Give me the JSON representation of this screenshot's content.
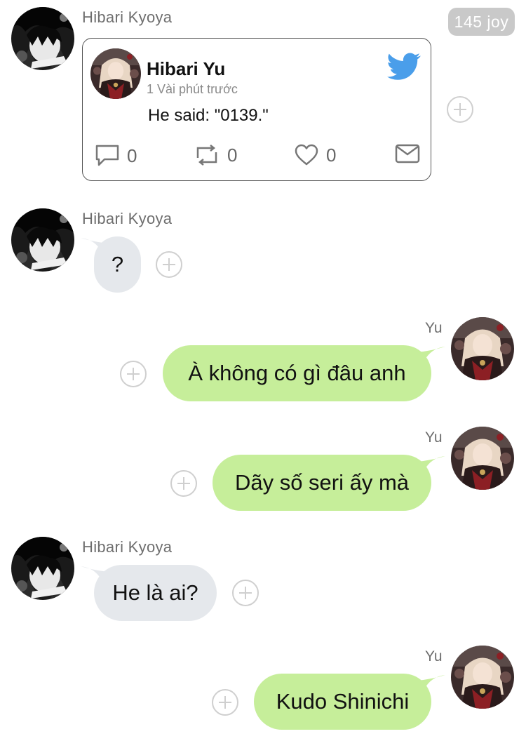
{
  "badge": {
    "text": "145 joy"
  },
  "names": {
    "other": "Hibari Kyoya",
    "self": "Yu"
  },
  "tweet": {
    "author": "Hibari Yu",
    "time": "1 Vài phút trước",
    "text": "He said: \"0139.\"",
    "replies": "0",
    "retweets": "0",
    "likes": "0"
  },
  "messages": [
    {
      "sender": "Hibari Kyoya",
      "direction": "incoming",
      "type": "tweet-share"
    },
    {
      "sender": "Hibari Kyoya",
      "direction": "incoming",
      "text": "?"
    },
    {
      "sender": "Yu",
      "direction": "outgoing",
      "text": "À không có gì đâu anh"
    },
    {
      "sender": "Yu",
      "direction": "outgoing",
      "text": "Dãy số seri ấy mà"
    },
    {
      "sender": "Hibari Kyoya",
      "direction": "incoming",
      "text": "He là ai?"
    },
    {
      "sender": "Yu",
      "direction": "outgoing",
      "text": "Kudo Shinichi"
    }
  ],
  "colors": {
    "incoming_bubble": "#e5e8ec",
    "outgoing_bubble": "#c6ee9a",
    "twitter_blue": "#4a9eea",
    "badge": "#c9c9c9"
  },
  "icons": {
    "reply": "speech-bubble-icon",
    "retweet": "retweet-icon",
    "like": "heart-icon",
    "share": "mail-icon",
    "platform": "twitter-bird-icon",
    "react": "plus-icon"
  }
}
